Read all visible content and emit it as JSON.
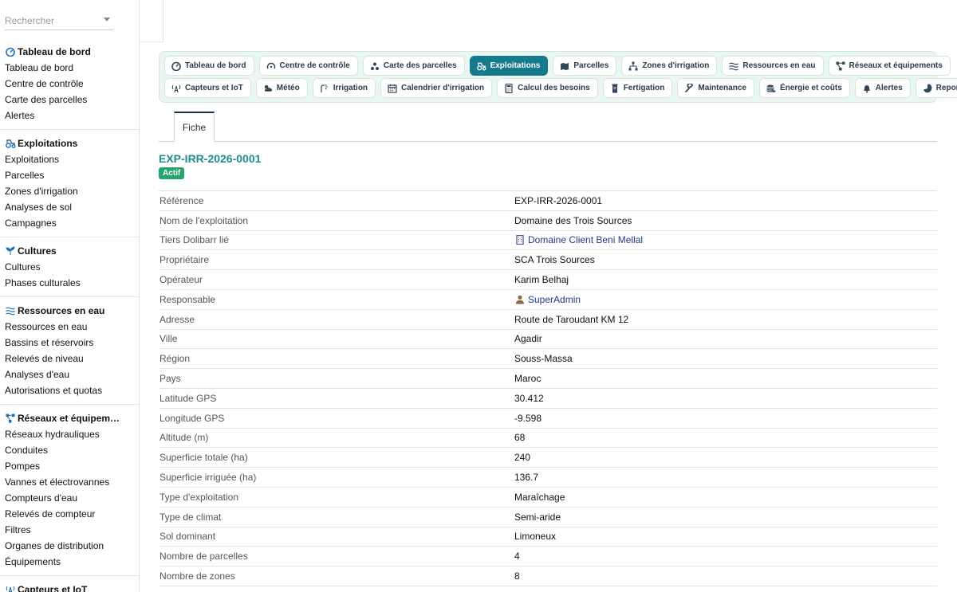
{
  "search": {
    "placeholder": "Rechercher"
  },
  "sidebar": {
    "sections": [
      {
        "title": "Tableau de bord",
        "icon": "dashboard-icon",
        "items": [
          "Tableau de bord",
          "Centre de contrôle",
          "Carte des parcelles",
          "Alertes"
        ]
      },
      {
        "title": "Exploitations",
        "icon": "tractor-icon",
        "items": [
          "Exploitations",
          "Parcelles",
          "Zones d'irrigation",
          "Analyses de sol",
          "Campagnes"
        ]
      },
      {
        "title": "Cultures",
        "icon": "seedling-icon",
        "items": [
          "Cultures",
          "Phases culturales"
        ]
      },
      {
        "title": "Ressources en eau",
        "icon": "water-icon",
        "items": [
          "Ressources en eau",
          "Bassins et réservoirs",
          "Relevés de niveau",
          "Analyses d'eau",
          "Autorisations et quotas"
        ]
      },
      {
        "title": "Réseaux et équipem…",
        "icon": "network-icon",
        "items": [
          "Réseaux hydrauliques",
          "Conduites",
          "Pompes",
          "Vannes et électrovannes",
          "Compteurs d'eau",
          "Relevés de compteur",
          "Filtres",
          "Organes de distribution",
          "Équipements"
        ]
      },
      {
        "title": "Capteurs et IoT",
        "icon": "sensor-icon",
        "items": []
      }
    ]
  },
  "nav": {
    "row1": [
      {
        "label": "Tableau de bord",
        "icon": "dashboard-icon"
      },
      {
        "label": "Centre de contrôle",
        "icon": "control-icon"
      },
      {
        "label": "Carte des parcelles",
        "icon": "map-icon"
      },
      {
        "label": "Exploitations",
        "icon": "tractor-icon",
        "active": true
      },
      {
        "label": "Parcelles",
        "icon": "parcels-icon"
      },
      {
        "label": "Zones d'irrigation",
        "icon": "zones-icon"
      },
      {
        "label": "Ressources en eau",
        "icon": "water-icon"
      },
      {
        "label": "Réseaux et équipements",
        "icon": "network-icon"
      }
    ],
    "row2": [
      {
        "label": "Capteurs et IoT",
        "icon": "sensor-icon"
      },
      {
        "label": "Météo",
        "icon": "weather-icon"
      },
      {
        "label": "Irrigation",
        "icon": "irrigation-icon"
      },
      {
        "label": "Calendrier d'irrigation",
        "icon": "calendar-icon"
      },
      {
        "label": "Calcul des besoins",
        "icon": "calculator-icon"
      },
      {
        "label": "Fertigation",
        "icon": "fertigation-icon"
      },
      {
        "label": "Maintenance",
        "icon": "wrench-icon"
      },
      {
        "label": "Énergie et coûts",
        "icon": "coins-icon"
      },
      {
        "label": "Alertes",
        "icon": "bell-icon"
      },
      {
        "label": "Reporting",
        "icon": "chart-icon"
      }
    ]
  },
  "tab": {
    "label": "Fiche"
  },
  "record": {
    "ref": "EXP-IRR-2026-0001",
    "status": "Actif",
    "fields": [
      {
        "label": "Référence",
        "value": "EXP-IRR-2026-0001"
      },
      {
        "label": "Nom de l'exploitation",
        "value": "Domaine des Trois Sources"
      },
      {
        "label": "Tiers Dolibarr lié",
        "value": "Domaine Client Beni Mellal",
        "link": true,
        "icon": "building-icon"
      },
      {
        "label": "Propriétaire",
        "value": "SCA Trois Sources"
      },
      {
        "label": "Opérateur",
        "value": "Karim Belhaj"
      },
      {
        "label": "Responsable",
        "value": "SuperAdmin",
        "link": true,
        "icon": "user-icon"
      },
      {
        "label": "Adresse",
        "value": "Route de Taroudant KM 12"
      },
      {
        "label": "Ville",
        "value": "Agadir"
      },
      {
        "label": "Région",
        "value": "Souss-Massa"
      },
      {
        "label": "Pays",
        "value": "Maroc"
      },
      {
        "label": "Latitude GPS",
        "value": "30.412"
      },
      {
        "label": "Longitude GPS",
        "value": "-9.598"
      },
      {
        "label": "Altitude (m)",
        "value": "68"
      },
      {
        "label": "Superficie totale (ha)",
        "value": "240"
      },
      {
        "label": "Superficie irriguée (ha)",
        "value": "136.7"
      },
      {
        "label": "Type d'exploitation",
        "value": "Maraîchage"
      },
      {
        "label": "Type de climat",
        "value": "Semi-aride"
      },
      {
        "label": "Sol dominant",
        "value": "Limoneux"
      },
      {
        "label": "Nombre de parcelles",
        "value": "4"
      },
      {
        "label": "Nombre de zones",
        "value": "8"
      }
    ]
  }
}
